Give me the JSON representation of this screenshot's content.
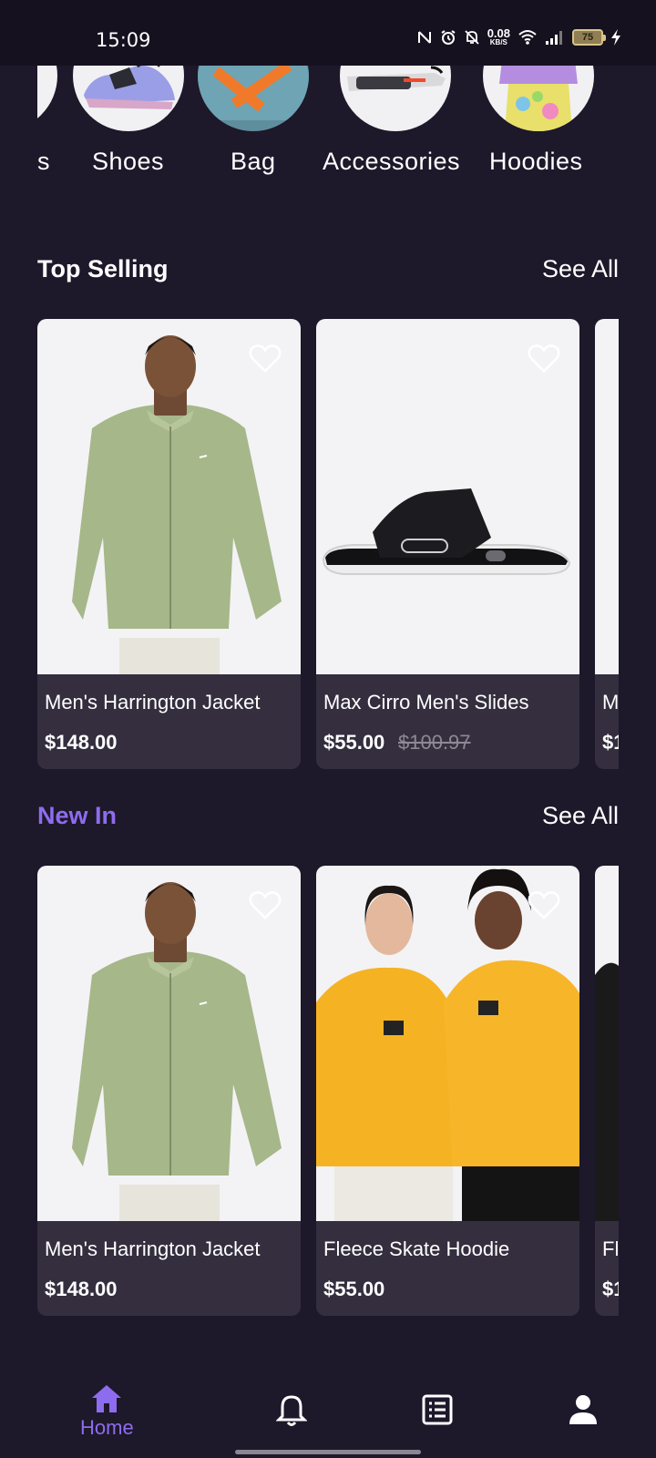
{
  "status_bar": {
    "time": "15:09",
    "net_speed_value": "0.08",
    "net_speed_unit": "KB/S",
    "battery": "75"
  },
  "categories": [
    {
      "label": "s",
      "icon": "partial-category-image"
    },
    {
      "label": "Shoes",
      "icon": "sneaker-image"
    },
    {
      "label": "Bag",
      "icon": "duffel-bag-image"
    },
    {
      "label": "Accessories",
      "icon": "sunglasses-image"
    },
    {
      "label": "Hoodies",
      "icon": "hoodie-image"
    }
  ],
  "top_selling": {
    "title": "Top Selling",
    "see_all": "See All",
    "title_color": "#ffffff",
    "products": [
      {
        "name": "Men's Harrington Jacket",
        "price": "$148.00",
        "old_price": ""
      },
      {
        "name": "Max Cirro Men's Slides",
        "price": "$55.00",
        "old_price": "$100.97"
      },
      {
        "name": "M",
        "price": "$1",
        "old_price": ""
      }
    ]
  },
  "new_in": {
    "title": "New In",
    "see_all": "See All",
    "title_color": "#8e6cef",
    "products": [
      {
        "name": "Men's Harrington Jacket",
        "price": "$148.00",
        "old_price": ""
      },
      {
        "name": "Fleece Skate Hoodie",
        "price": "$55.00",
        "old_price": ""
      },
      {
        "name": "Fl",
        "price": "$1",
        "old_price": ""
      }
    ]
  },
  "bottom_nav": {
    "items": [
      {
        "label": "Home",
        "icon": "home-icon",
        "active": true
      },
      {
        "label": "",
        "icon": "bell-icon",
        "active": false
      },
      {
        "label": "",
        "icon": "orders-icon",
        "active": false
      },
      {
        "label": "",
        "icon": "profile-icon",
        "active": false
      }
    ]
  },
  "colors": {
    "background": "#1d182a",
    "card": "#342e3f",
    "accent": "#8e6cef",
    "status_bar": "#15111f"
  }
}
